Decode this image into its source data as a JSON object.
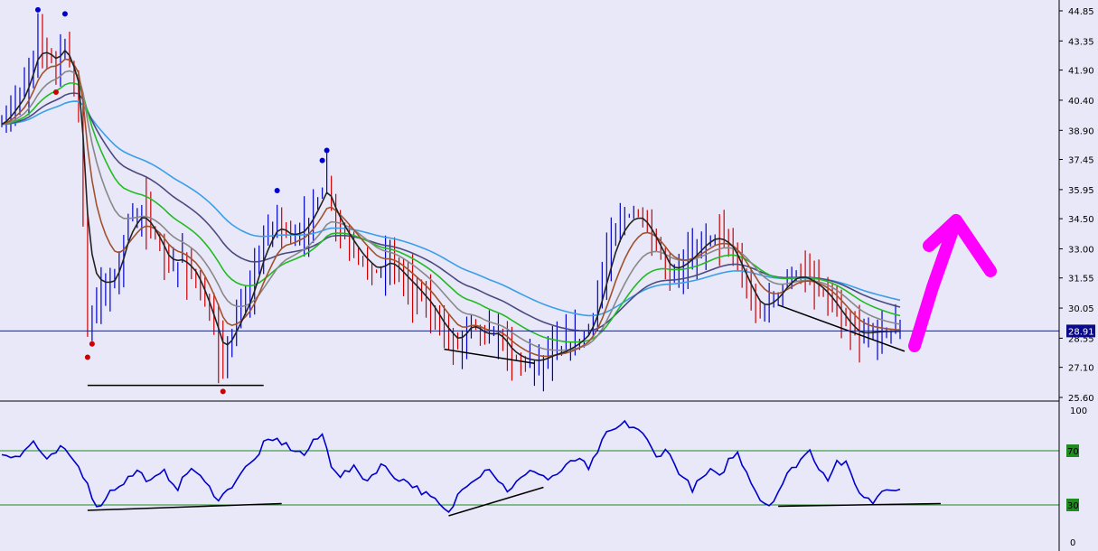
{
  "chart_data": [
    {
      "type": "candlestick",
      "panel": "price",
      "ylim": [
        25.6,
        44.85
      ],
      "y_ticks": [
        "44.85",
        "43.35",
        "41.90",
        "40.40",
        "38.90",
        "37.45",
        "35.95",
        "34.50",
        "33.00",
        "31.55",
        "30.05",
        "28.55",
        "27.10",
        "25.60"
      ],
      "current_price": "28.91",
      "n_bars": 200,
      "price_path": [
        [
          0,
          39.2
        ],
        [
          5,
          41.0
        ],
        [
          8,
          43.5
        ],
        [
          12,
          42.2
        ],
        [
          14,
          43.3
        ],
        [
          17,
          40.2
        ],
        [
          19,
          29.0
        ],
        [
          22,
          31.0
        ],
        [
          25,
          31.5
        ],
        [
          28,
          34.5
        ],
        [
          31,
          35.0
        ],
        [
          34,
          33.5
        ],
        [
          37,
          32.0
        ],
        [
          40,
          32.5
        ],
        [
          43,
          31.5
        ],
        [
          46,
          29.5
        ],
        [
          49,
          27.3
        ],
        [
          52,
          29.5
        ],
        [
          55,
          31.0
        ],
        [
          58,
          33.5
        ],
        [
          61,
          34.5
        ],
        [
          64,
          33.5
        ],
        [
          67,
          34.0
        ],
        [
          70,
          35.5
        ],
        [
          72,
          36.5
        ],
        [
          74,
          34.2
        ],
        [
          77,
          33.2
        ],
        [
          80,
          32.3
        ],
        [
          83,
          31.8
        ],
        [
          86,
          32.5
        ],
        [
          89,
          31.5
        ],
        [
          92,
          30.8
        ],
        [
          95,
          30.0
        ],
        [
          98,
          28.8
        ],
        [
          101,
          28.2
        ],
        [
          104,
          29.5
        ],
        [
          107,
          28.6
        ],
        [
          110,
          28.8
        ],
        [
          113,
          27.6
        ],
        [
          116,
          27.4
        ],
        [
          119,
          27.4
        ],
        [
          122,
          27.8
        ],
        [
          125,
          28.0
        ],
        [
          128,
          28.5
        ],
        [
          130,
          29.0
        ],
        [
          132,
          30.5
        ],
        [
          134,
          32.5
        ],
        [
          136,
          34.0
        ],
        [
          138,
          34.6
        ],
        [
          140,
          34.8
        ],
        [
          142,
          34.5
        ],
        [
          144,
          33.5
        ],
        [
          146,
          32.5
        ],
        [
          148,
          31.6
        ],
        [
          150,
          32.0
        ],
        [
          152,
          32.5
        ],
        [
          154,
          33.0
        ],
        [
          156,
          33.5
        ],
        [
          158,
          33.7
        ],
        [
          160,
          33.4
        ],
        [
          162,
          32.8
        ],
        [
          164,
          31.5
        ],
        [
          166,
          30.5
        ],
        [
          168,
          29.8
        ],
        [
          170,
          30.2
        ],
        [
          172,
          30.8
        ],
        [
          174,
          31.5
        ],
        [
          176,
          31.8
        ],
        [
          178,
          31.6
        ],
        [
          180,
          31.2
        ],
        [
          182,
          30.8
        ],
        [
          184,
          30.2
        ],
        [
          186,
          29.5
        ],
        [
          188,
          28.9
        ],
        [
          190,
          28.6
        ],
        [
          192,
          28.8
        ],
        [
          194,
          28.9
        ],
        [
          199,
          28.9
        ]
      ],
      "moving_averages": [
        {
          "color": "#3a9fe8",
          "period": 60
        },
        {
          "color": "#4a4a80",
          "period": 40
        },
        {
          "color": "#22bb22",
          "period": 26
        },
        {
          "color": "#888888",
          "period": 16
        },
        {
          "color": "#a0522d",
          "period": 9
        },
        {
          "color": "#222222",
          "period": 4
        }
      ],
      "colors": {
        "up": "#0000cc",
        "down": "#cc0000",
        "background": "#e8e8f8"
      }
    },
    {
      "type": "line",
      "panel": "oscillator",
      "ylim": [
        0,
        100
      ],
      "y_ticks": [
        "100",
        "70",
        "30",
        "0"
      ],
      "levels": [
        70,
        30
      ],
      "level_labels": [
        "70",
        "30"
      ],
      "osc_path": [
        [
          0,
          68
        ],
        [
          4,
          66
        ],
        [
          7,
          77
        ],
        [
          10,
          62
        ],
        [
          13,
          72
        ],
        [
          16,
          63
        ],
        [
          19,
          47
        ],
        [
          21,
          27
        ],
        [
          24,
          40
        ],
        [
          27,
          47
        ],
        [
          30,
          55
        ],
        [
          33,
          47
        ],
        [
          36,
          54
        ],
        [
          39,
          43
        ],
        [
          42,
          58
        ],
        [
          45,
          46
        ],
        [
          48,
          35
        ],
        [
          50,
          40
        ],
        [
          53,
          54
        ],
        [
          56,
          63
        ],
        [
          58,
          75
        ],
        [
          61,
          78
        ],
        [
          64,
          72
        ],
        [
          67,
          67
        ],
        [
          69,
          76
        ],
        [
          71,
          82
        ],
        [
          73,
          60
        ],
        [
          75,
          52
        ],
        [
          78,
          57
        ],
        [
          81,
          48
        ],
        [
          84,
          60
        ],
        [
          87,
          51
        ],
        [
          90,
          47
        ],
        [
          93,
          40
        ],
        [
          96,
          33
        ],
        [
          99,
          23
        ],
        [
          101,
          37
        ],
        [
          103,
          46
        ],
        [
          106,
          53
        ],
        [
          108,
          58
        ],
        [
          110,
          48
        ],
        [
          112,
          41
        ],
        [
          115,
          49
        ],
        [
          118,
          56
        ],
        [
          121,
          49
        ],
        [
          124,
          55
        ],
        [
          126,
          61
        ],
        [
          128,
          65
        ],
        [
          130,
          55
        ],
        [
          132,
          70
        ],
        [
          134,
          82
        ],
        [
          136,
          86
        ],
        [
          138,
          90
        ],
        [
          141,
          86
        ],
        [
          143,
          77
        ],
        [
          145,
          65
        ],
        [
          147,
          72
        ],
        [
          149,
          60
        ],
        [
          151,
          50
        ],
        [
          153,
          42
        ],
        [
          155,
          49
        ],
        [
          157,
          55
        ],
        [
          159,
          50
        ],
        [
          161,
          63
        ],
        [
          163,
          68
        ],
        [
          166,
          48
        ],
        [
          168,
          34
        ],
        [
          170,
          30
        ],
        [
          172,
          40
        ],
        [
          174,
          52
        ],
        [
          177,
          64
        ],
        [
          179,
          70
        ],
        [
          181,
          58
        ],
        [
          183,
          50
        ],
        [
          185,
          62
        ],
        [
          187,
          60
        ],
        [
          189,
          45
        ],
        [
          191,
          36
        ],
        [
          193,
          32
        ],
        [
          195,
          41
        ],
        [
          198,
          43
        ],
        [
          199,
          43
        ]
      ],
      "colors": {
        "line": "#0000cc",
        "levels": "#1e8c1e",
        "badge": "#1e8c1e"
      }
    }
  ]
}
